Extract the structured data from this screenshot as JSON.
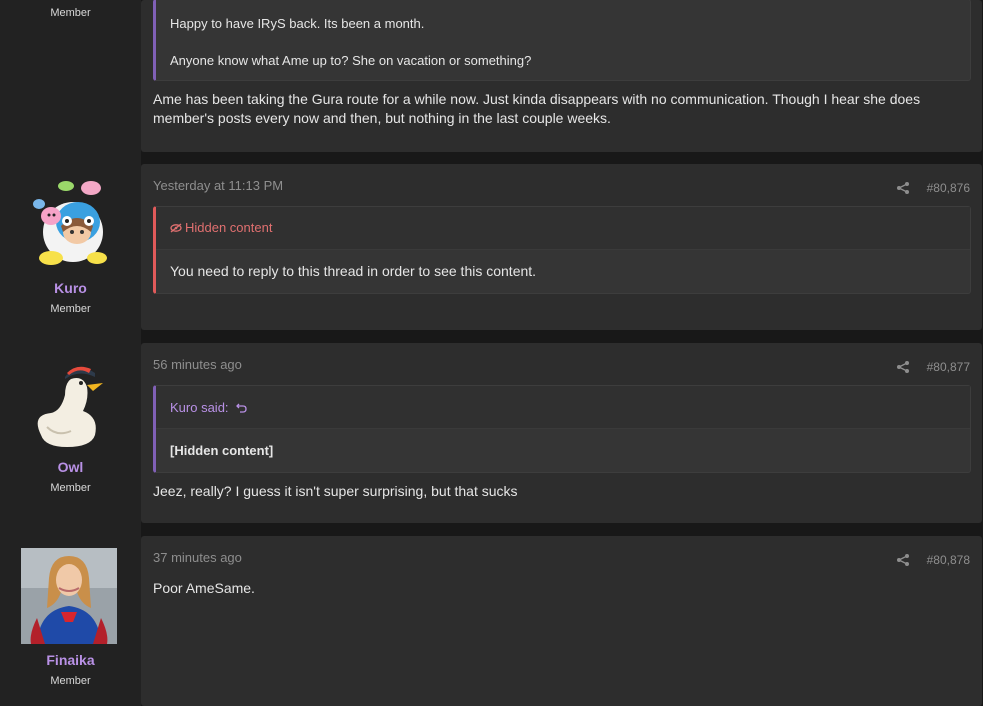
{
  "posts": [
    {
      "user": {
        "name": "",
        "role": "Member"
      },
      "quote_lines": [
        "Happy to have IRyS back. Its been a month.",
        "Anyone know what Ame up to? She on vacation or something?"
      ],
      "body": "Ame has been taking the Gura route for a while now. Just kinda disappears with no communication. Though I hear she does member's posts every now and then, but nothing in the last couple weeks."
    },
    {
      "user": {
        "name": "Kuro",
        "role": "Member"
      },
      "time": "Yesterday at 11:13 PM",
      "number": "#80,876",
      "hidden_label": "Hidden content",
      "hidden_message": "You need to reply to this thread in order to see this content."
    },
    {
      "user": {
        "name": "Owl",
        "role": "Member"
      },
      "time": "56 minutes ago",
      "number": "#80,877",
      "quote_author": "Kuro said:",
      "quote_body": "[Hidden content]",
      "body": "Jeez, really? I guess it isn't super surprising, but that sucks"
    },
    {
      "user": {
        "name": "Finaika",
        "role": "Member"
      },
      "time": "37 minutes ago",
      "number": "#80,878",
      "body": "Poor AmeSame."
    }
  ],
  "colors": {
    "accent": "#b991e6",
    "quote_border": "#8060b6",
    "hidden": "#e05a5a",
    "panel": "#2d2d2d",
    "sidebar": "#222222"
  },
  "icons": [
    "share-icon",
    "eye-slash-icon",
    "return-arrow-icon"
  ]
}
